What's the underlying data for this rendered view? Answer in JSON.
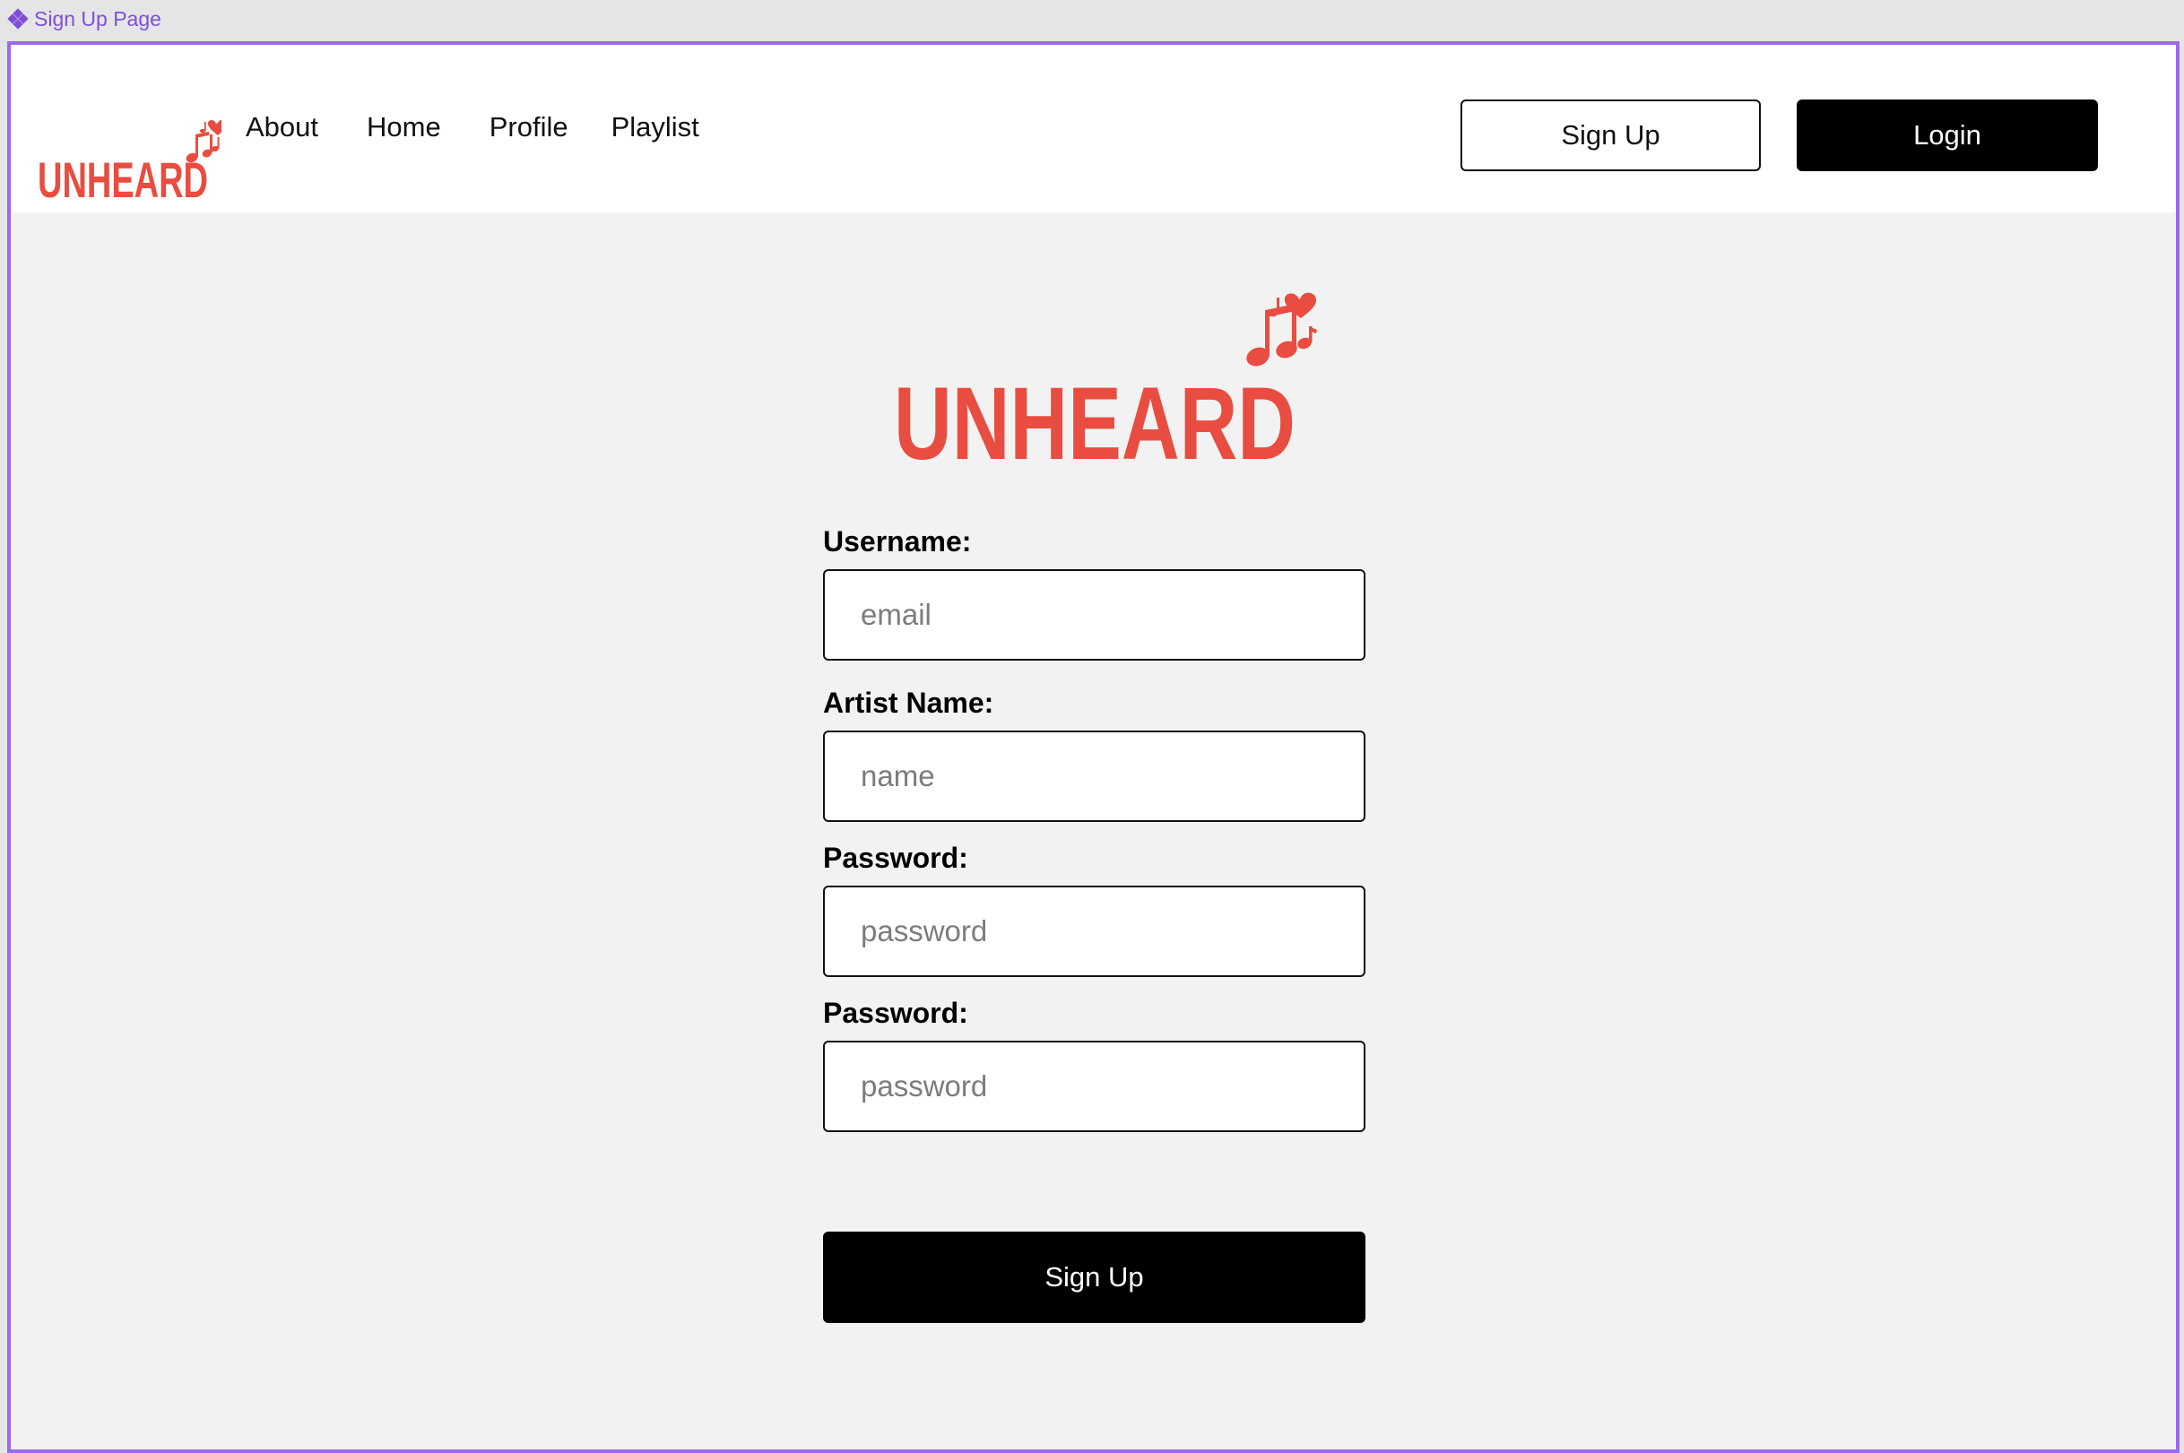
{
  "frame": {
    "label": "Sign Up Page",
    "icon": "component-icon"
  },
  "brand": {
    "name": "UNHEARD",
    "color": "#e94c40"
  },
  "nav": {
    "links": [
      "About",
      "Home",
      "Profile",
      "Playlist"
    ],
    "signup_label": "Sign Up",
    "login_label": "Login"
  },
  "form": {
    "username": {
      "label": "Username:",
      "placeholder": "email"
    },
    "artist_name": {
      "label": "Artist Name:",
      "placeholder": "name"
    },
    "password": {
      "label": "Password:",
      "placeholder": "password"
    },
    "password_confirm": {
      "label": "Password:",
      "placeholder": "password"
    },
    "submit_label": "Sign Up"
  },
  "colors": {
    "frame_border": "#9b69ea",
    "background": "#f2f2f2",
    "primary_button": "#000000"
  }
}
